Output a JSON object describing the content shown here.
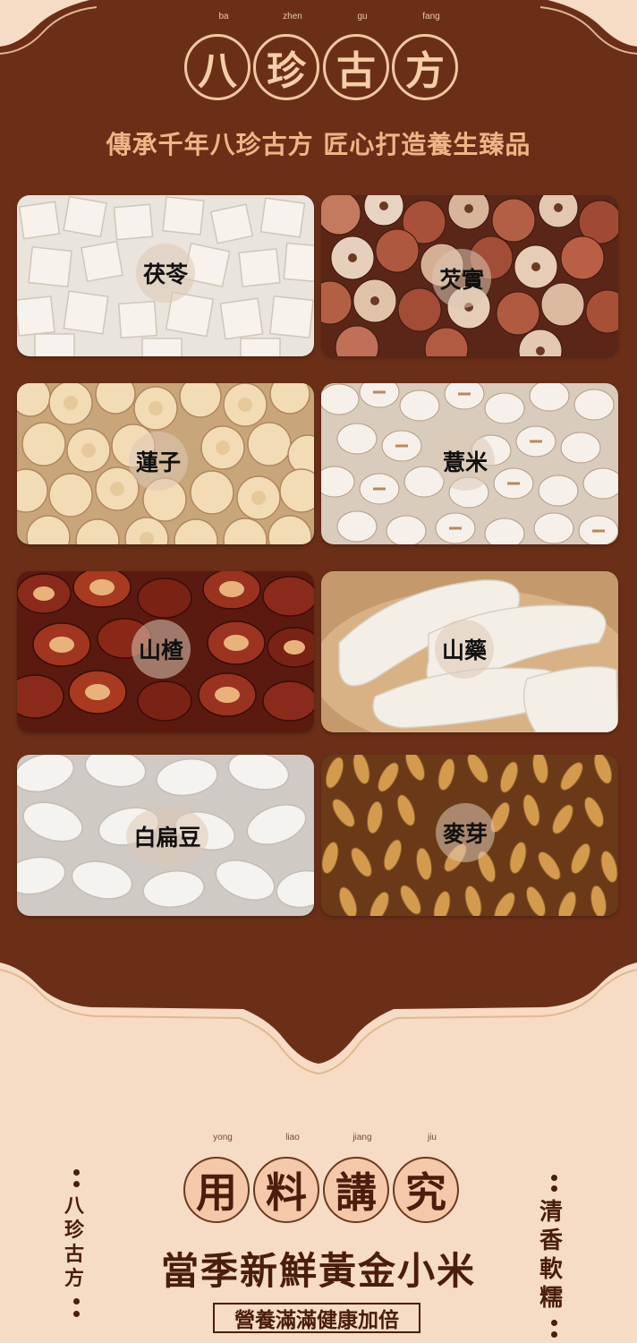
{
  "header": {
    "pinyin": [
      "ba",
      "zhen",
      "gu",
      "fang"
    ],
    "title_chars": [
      "八",
      "珍",
      "古",
      "方"
    ],
    "subtitle": "傳承千年八珍古方 匠心打造養生臻品"
  },
  "ingredients": [
    {
      "label": "茯苓"
    },
    {
      "label": "芡實"
    },
    {
      "label": "蓮子"
    },
    {
      "label": "薏米"
    },
    {
      "label": "山楂"
    },
    {
      "label": "山藥"
    },
    {
      "label": "白扁豆"
    },
    {
      "label": "麥芽"
    }
  ],
  "section2": {
    "pinyin": [
      "yong",
      "liao",
      "jiang",
      "jiu"
    ],
    "title_chars": [
      "用",
      "料",
      "講",
      "究"
    ],
    "main_text": "當季新鮮黃金小米",
    "boxed_text": "營養滿滿健康加倍",
    "left_vertical": [
      "八",
      "珍",
      "古",
      "方"
    ],
    "right_vertical": [
      "清",
      "香",
      "軟",
      "糯"
    ]
  },
  "colors": {
    "panel": "#6b2f18",
    "background": "#f6dcc4",
    "accent": "#f0b487",
    "text_dark": "#4a1d0c"
  }
}
